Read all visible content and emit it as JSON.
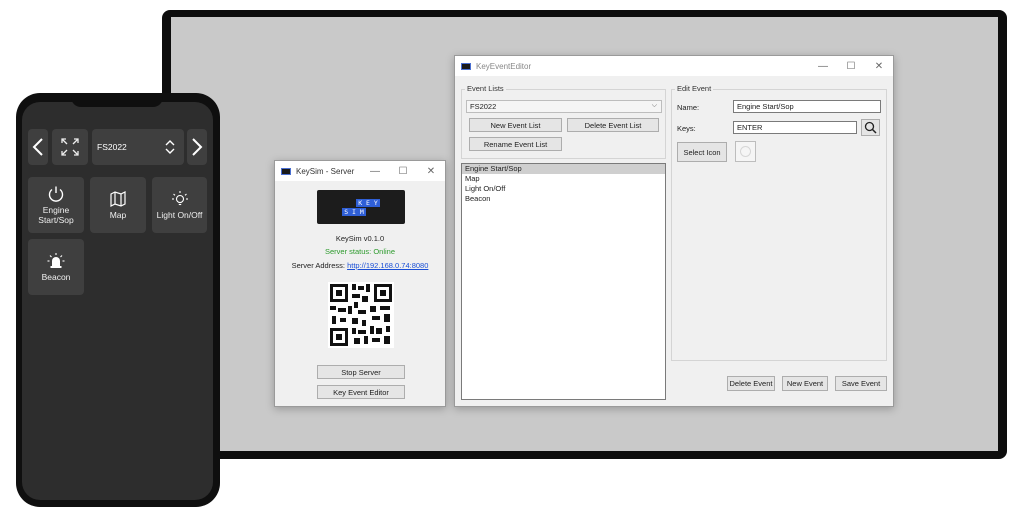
{
  "phone": {
    "event_list_selected": "FS2022",
    "tiles": [
      {
        "label": "Engine Start/Sop",
        "icon": "power-icon"
      },
      {
        "label": "Map",
        "icon": "map-icon"
      },
      {
        "label": "Light On/Off",
        "icon": "lightbulb-icon"
      },
      {
        "label": "Beacon",
        "icon": "beacon-icon"
      }
    ]
  },
  "server": {
    "title": "KeySim - Server",
    "logo_text_top": "K E Y",
    "logo_text_bottom": "S I M",
    "version": "KeySim v0.1.0",
    "status": "Server status: Online",
    "address_label": "Server Address:",
    "address_url": "http://192.168.0.74:8080",
    "stop_label": "Stop Server",
    "editor_label": "Key Event Editor",
    "colors": {
      "status": "#2e9b2e",
      "link": "#1a4fd6"
    }
  },
  "editor": {
    "title": "KeyEventEditor",
    "event_lists_label": "Event Lists",
    "selected_list": "FS2022",
    "new_list_label": "New Event List",
    "delete_list_label": "Delete Event List",
    "rename_list_label": "Rename Event List",
    "events": [
      "Engine Start/Sop",
      "Map",
      "Light On/Off",
      "Beacon"
    ],
    "edit_label": "Edit Event",
    "name_label": "Name:",
    "name_value": "Engine Start/Sop",
    "keys_label": "Keys:",
    "keys_value": "ENTER",
    "select_icon_label": "Select Icon",
    "delete_event_label": "Delete Event",
    "new_event_label": "New Event",
    "save_event_label": "Save Event"
  },
  "window_controls": {
    "minimize": "—",
    "maximize": "☐",
    "close": "✕"
  }
}
